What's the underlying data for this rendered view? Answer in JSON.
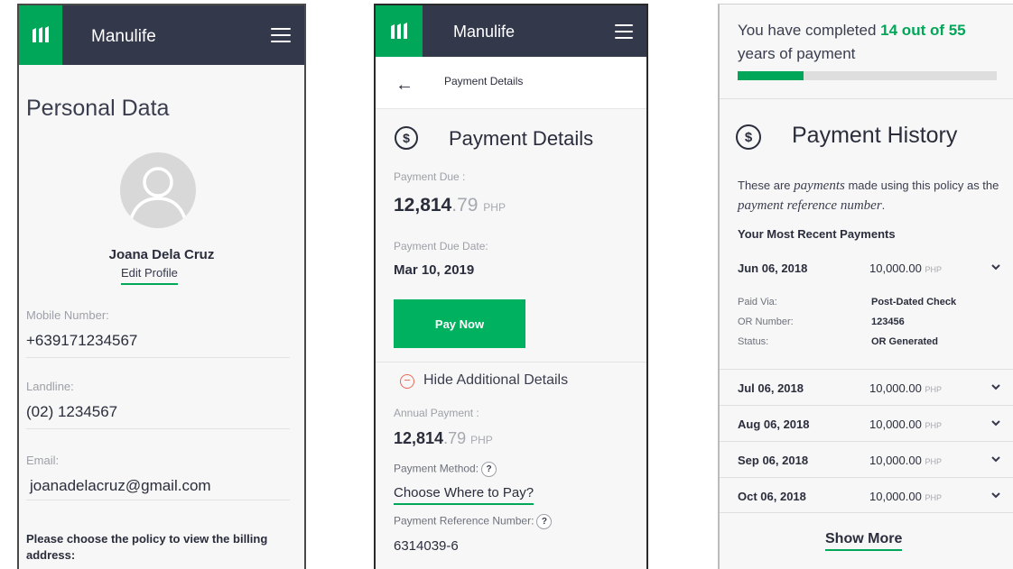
{
  "colors": {
    "brand_green": "#00a758",
    "header_navy": "#34384b",
    "pay_button": "#00b25f",
    "danger_icon": "#e86a58"
  },
  "header": {
    "brand": "Manulife",
    "logo_icon": "manulife-logo-icon",
    "menu_icon": "hamburger-menu-icon"
  },
  "personal": {
    "title": "Personal Data",
    "avatar_icon": "user-avatar-icon",
    "name": "Joana Dela Cruz",
    "edit_profile": "Edit Profile",
    "fields": [
      {
        "label": "Mobile Number:",
        "value": "+639171234567"
      },
      {
        "label": "Landline:",
        "value": "(02) 1234567"
      },
      {
        "label": "Email:",
        "value": "joanadelacruz@gmail.com"
      }
    ],
    "policy_prompt": "Please choose the policy to view the billing address:"
  },
  "payment": {
    "subheader": "Payment Details",
    "back_icon": "arrow-left-icon",
    "title": "Payment Details",
    "dollar_icon": "dollar-circle-icon",
    "due_label": "Payment Due :",
    "due_whole": "12,814",
    "due_decimal": ".79",
    "due_currency": "PHP",
    "due_date_label": "Payment Due Date:",
    "due_date": "Mar 10, 2019",
    "pay_now": "Pay Now",
    "hide_details": "Hide Additional Details",
    "annual_label": "Annual Payment :",
    "annual_whole": "12,814",
    "annual_decimal": ".79",
    "annual_currency": "PHP",
    "method_label": "Payment Method:",
    "help_glyph": "?",
    "choose_where": "Choose Where to Pay?",
    "reference_label": "Payment Reference Number:",
    "reference_number": "6314039-6"
  },
  "history": {
    "completed_prefix": "You have completed",
    "completed_count": "14 out of 55",
    "completed_suffix": "years of payment",
    "progress_fraction": 0.2545,
    "title": "Payment History",
    "intro_1": "These are",
    "intro_em1": "payments",
    "intro_2": "made using this policy as the",
    "intro_em2": "payment reference number",
    "intro_3": ".",
    "recent_label": "Your Most Recent Payments",
    "rows": [
      {
        "date": "Jun 06, 2018",
        "amount": "10,000.00",
        "currency": "PHP"
      },
      {
        "date": "Jul 06, 2018",
        "amount": "10,000.00",
        "currency": "PHP"
      },
      {
        "date": "Aug 06, 2018",
        "amount": "10,000.00",
        "currency": "PHP"
      },
      {
        "date": "Sep 06, 2018",
        "amount": "10,000.00",
        "currency": "PHP"
      },
      {
        "date": "Oct 06, 2018",
        "amount": "10,000.00",
        "currency": "PHP"
      }
    ],
    "detail": [
      {
        "label": "Paid Via:",
        "value": "Post-Dated Check"
      },
      {
        "label": "OR Number:",
        "value": "123456"
      },
      {
        "label": "Status:",
        "value": "OR Generated"
      }
    ],
    "chevron_icon": "chevron-down-icon",
    "show_more": "Show More"
  }
}
